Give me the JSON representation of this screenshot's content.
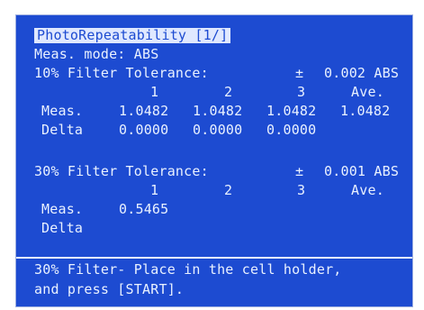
{
  "screen": {
    "title": "PhotoRepeatability [1/]",
    "meas_mode": "Meas. mode: ABS",
    "section1": {
      "label": "10% Filter Tolerance:",
      "pm": "±",
      "tolerance": "0.002 ABS",
      "headers": [
        "1",
        "2",
        "3",
        "Ave."
      ],
      "meas_label": "Meas.",
      "meas_values": [
        "1.0482",
        "1.0482",
        "1.0482",
        "1.0482"
      ],
      "delta_label": "Delta",
      "delta_values": [
        "0.0000",
        "0.0000",
        "0.0000"
      ]
    },
    "section2": {
      "label": "30% Filter Tolerance:",
      "pm": "±",
      "tolerance": "0.001 ABS",
      "headers": [
        "1",
        "2",
        "3",
        "Ave."
      ],
      "meas_label": "Meas.",
      "meas_values": [
        "0.5465"
      ],
      "delta_label": "Delta"
    },
    "footer": {
      "line1": "30% Filter- Place in the cell holder,",
      "line2": "and press [START]."
    }
  },
  "colors": {
    "screen_bg": "#1d4bd1",
    "text": "#e9f1ff",
    "title_bg": "#dfe8ff"
  }
}
